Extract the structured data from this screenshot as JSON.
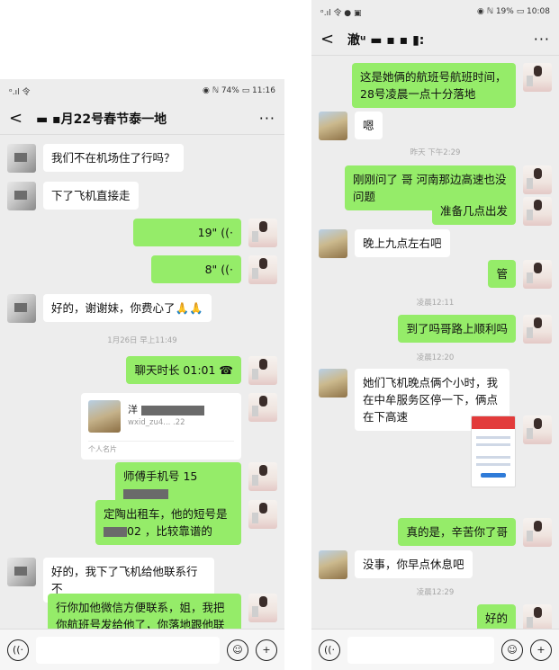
{
  "phone1": {
    "status": {
      "left": "ᵒ.ıl 令",
      "right": "◉ ℕ 74% ▭ 11:16"
    },
    "title": "▬ ▪月22号春节泰一地",
    "back": "<",
    "more": "···",
    "messages": [
      {
        "text": "我们不在机场住了行吗？"
      },
      {
        "text": "下了飞机直接走"
      },
      {
        "text": "19\" ((·"
      },
      {
        "text": "8\" ((·"
      },
      {
        "text": "好的，谢谢妹，你费心了🙏🙏"
      },
      {
        "text": "1月26日 早上11:49"
      },
      {
        "text": "聊天时长 01:01 ☎"
      },
      {
        "text": "师傅手机号 15",
        "suffix": ""
      },
      {
        "text": "定陶出租车，他的短号是",
        "line2": "02 ，比较靠谱的"
      },
      {
        "text": "好的，我下了飞机给他联系行不"
      },
      {
        "text": "行你加他微信方便联系，姐，我把你航班号发给他了，你落地跟他联"
      }
    ],
    "card": {
      "name": "洋",
      "wx": "wxid_zu4...           .22",
      "label": "个人名片"
    }
  },
  "phone2": {
    "status": {
      "left": "ᵒ.ıl 令 ● ▣",
      "right": "◉ ℕ 19% ▭ 10:08"
    },
    "title": "澈ᵘ ▬   ▪ ▪ ▮:",
    "back": "<",
    "more": "···",
    "messages": [
      {
        "text": "这是她俩的航班号航班时间，28号凌晨一点十分落地"
      },
      {
        "text": "嗯"
      },
      {
        "text": "昨天 下午2:29"
      },
      {
        "text": "刚刚问了 哥 河南那边高速也没问题"
      },
      {
        "text": "准备几点出发"
      },
      {
        "text": "晚上九点左右吧"
      },
      {
        "text": "管"
      },
      {
        "text": "凌晨12:11"
      },
      {
        "text": "到了吗哥路上顺利吗"
      },
      {
        "text": "凌晨12:20"
      },
      {
        "text": "她们飞机晚点俩个小时，我在中牟服务区停一下，俩点在下高速"
      },
      {
        "text": "真的是，辛苦你了哥"
      },
      {
        "text": "没事，你早点休息吧"
      },
      {
        "text": "凌晨12:29"
      },
      {
        "text": "好的"
      }
    ]
  },
  "inputbar": {
    "voice_icon": "((·",
    "emoji_icon": "☺",
    "plus_icon": "+"
  }
}
